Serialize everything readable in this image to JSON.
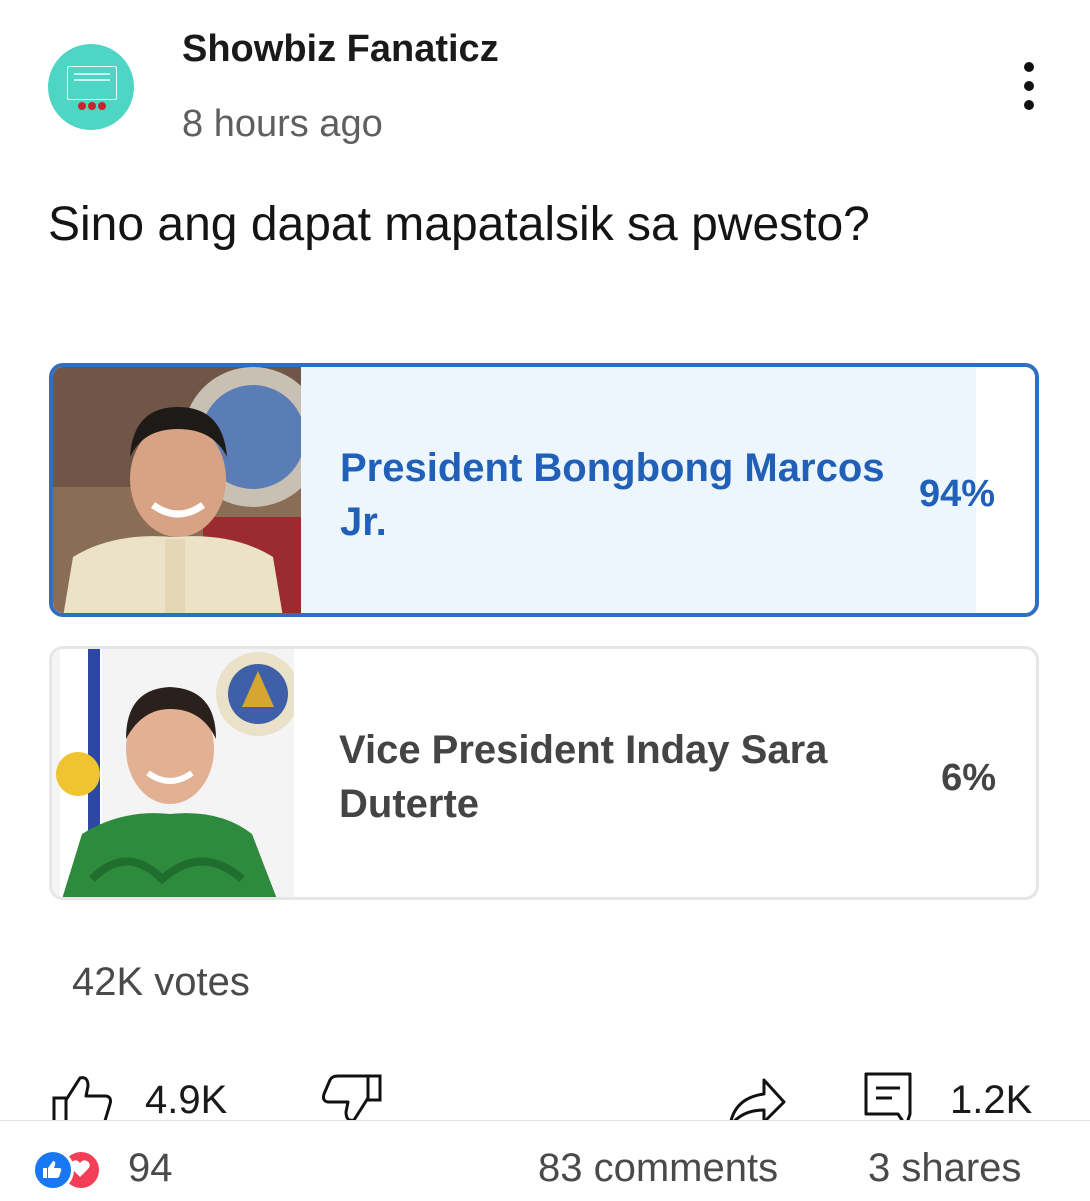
{
  "post": {
    "page_name": "Showbiz Fanaticz",
    "time": "8 hours ago",
    "question": "Sino ang dapat mapatalsik sa pwesto?"
  },
  "poll": {
    "options": [
      {
        "label": "President Bongbong Marcos Jr.",
        "percent_text": "94%",
        "percent": 94,
        "selected": true
      },
      {
        "label": "Vice President Inday Sara Duterte",
        "percent_text": "6%",
        "percent": 6,
        "selected": false
      }
    ],
    "votes": "42K votes"
  },
  "actions": {
    "upvotes": "4.9K",
    "comments": "1.2K",
    "icons": [
      "thumbs-up-icon",
      "thumbs-down-icon",
      "share-icon",
      "comment-icon"
    ]
  },
  "footer": {
    "reactions_count": "94",
    "comments": "83 comments",
    "shares": "3 shares",
    "icons": [
      "like-reaction-icon",
      "love-reaction-icon"
    ]
  },
  "colors": {
    "accent": "#2f6fc3",
    "selected_fill": "#edf5fd",
    "avatar_bg": "#4fd5c3",
    "like_blue": "#1877f2",
    "love_red": "#f33e58"
  }
}
